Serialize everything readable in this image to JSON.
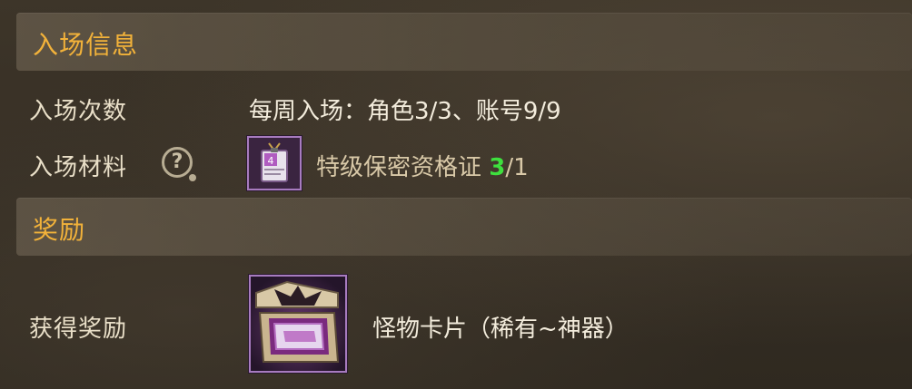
{
  "entry_section": {
    "title": "入场信息",
    "entry_count_label": "入场次数",
    "entry_count_value": "每周入场：角色3/3、账号9/9",
    "material_label": "入场材料",
    "material_name": "特级保密资格证",
    "material_have": "3",
    "material_need": "/1",
    "material_icon": "certificate-badge-icon",
    "help_icon": "question-mark-icon"
  },
  "reward_section": {
    "title": "奖励",
    "reward_label": "获得奖励",
    "reward_name": "怪物卡片（稀有~神器）",
    "reward_icon": "monster-card-box-icon"
  },
  "colors": {
    "header_text": "#f2b23a",
    "count_have": "#3ee03e",
    "item_border": "#a77bbf"
  }
}
